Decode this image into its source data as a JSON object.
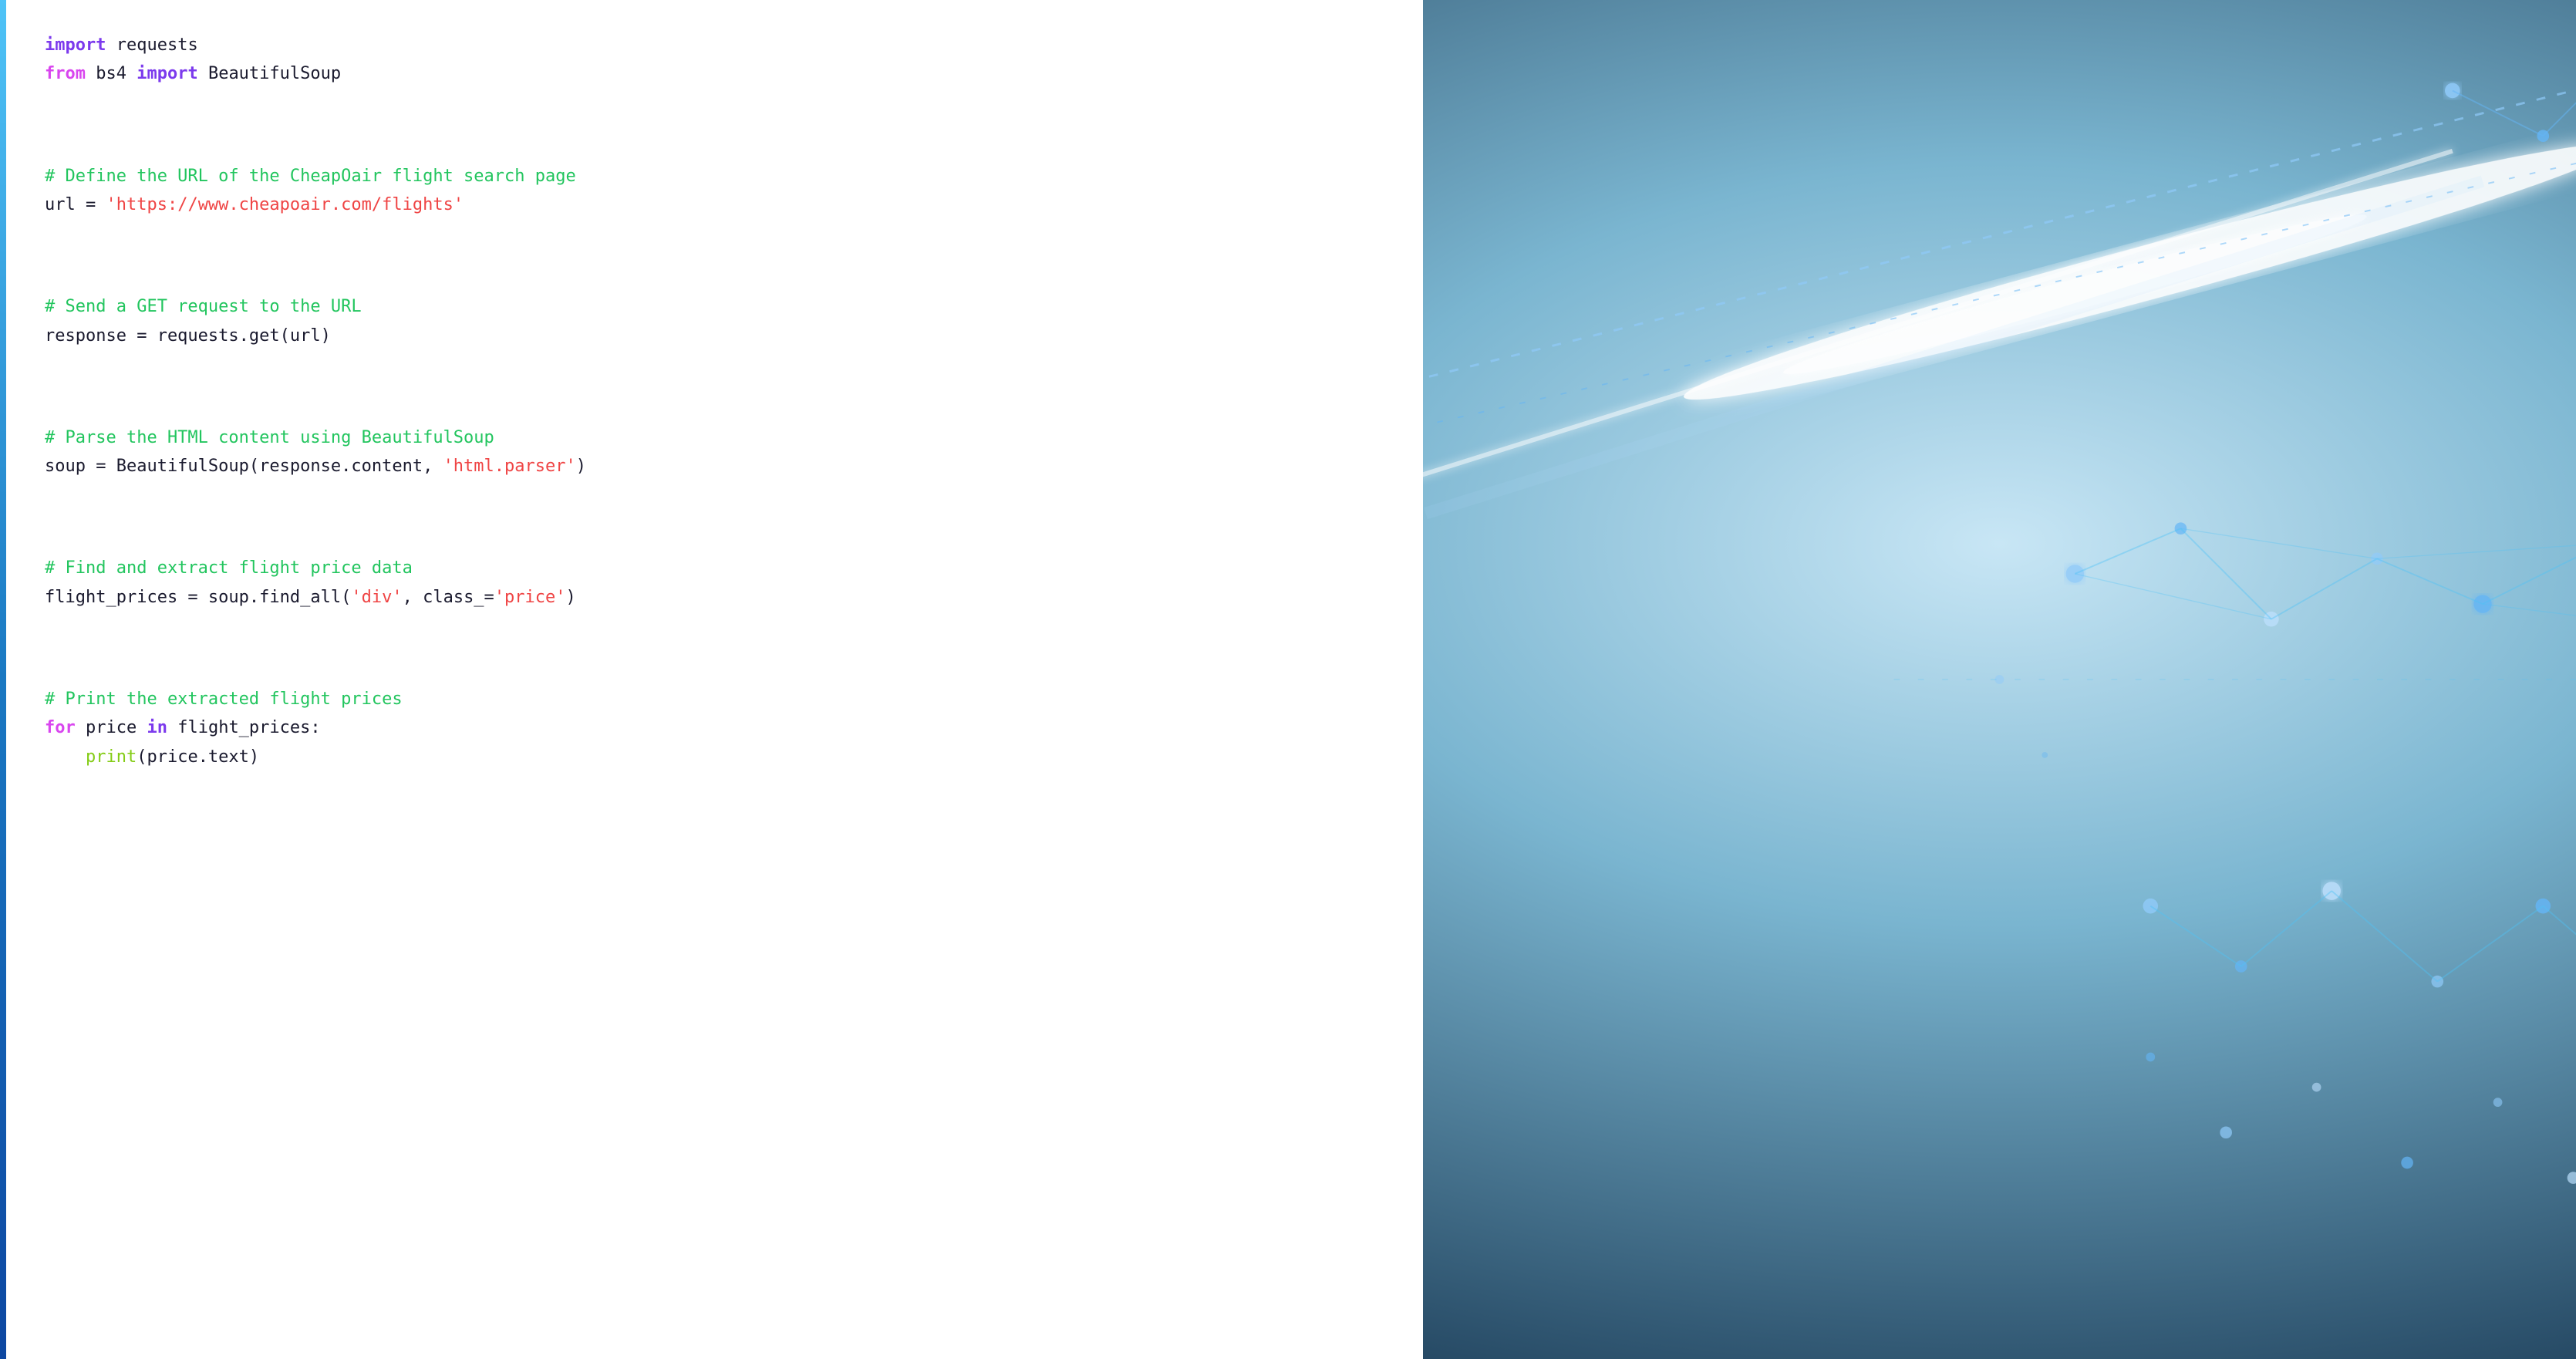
{
  "accent": {
    "color": "#4fc3f7"
  },
  "code": {
    "lines": [
      {
        "id": "line-import-requests",
        "tokens": [
          {
            "type": "kw-import",
            "text": "import"
          },
          {
            "type": "plain",
            "text": " requests"
          }
        ]
      },
      {
        "id": "line-from-bs4",
        "tokens": [
          {
            "type": "kw-from",
            "text": "from"
          },
          {
            "type": "plain",
            "text": " bs4 "
          },
          {
            "type": "kw-import",
            "text": "import"
          },
          {
            "type": "plain",
            "text": " BeautifulSoup"
          }
        ]
      },
      {
        "id": "line-blank-1",
        "tokens": [
          {
            "type": "plain",
            "text": ""
          }
        ]
      },
      {
        "id": "line-comment-url",
        "tokens": [
          {
            "type": "comment",
            "text": "# Define the URL of the CheapOair flight search page"
          }
        ]
      },
      {
        "id": "line-url",
        "tokens": [
          {
            "type": "plain",
            "text": "url = "
          },
          {
            "type": "string",
            "text": "'https://www.cheapoair.com/flights'"
          }
        ]
      },
      {
        "id": "line-blank-2",
        "tokens": [
          {
            "type": "plain",
            "text": ""
          }
        ]
      },
      {
        "id": "line-comment-get",
        "tokens": [
          {
            "type": "comment",
            "text": "# Send a GET request to the URL"
          }
        ]
      },
      {
        "id": "line-response",
        "tokens": [
          {
            "type": "plain",
            "text": "response = requests.get(url)"
          }
        ]
      },
      {
        "id": "line-blank-3",
        "tokens": [
          {
            "type": "plain",
            "text": ""
          }
        ]
      },
      {
        "id": "line-comment-parse",
        "tokens": [
          {
            "type": "comment",
            "text": "# Parse the HTML content using BeautifulSoup"
          }
        ]
      },
      {
        "id": "line-soup",
        "tokens": [
          {
            "type": "plain",
            "text": "soup = BeautifulSoup(response.content, "
          },
          {
            "type": "string",
            "text": "'html.parser'"
          },
          {
            "type": "plain",
            "text": ")"
          }
        ]
      },
      {
        "id": "line-blank-4",
        "tokens": [
          {
            "type": "plain",
            "text": ""
          }
        ]
      },
      {
        "id": "line-comment-find",
        "tokens": [
          {
            "type": "comment",
            "text": "# Find and extract flight price data"
          }
        ]
      },
      {
        "id": "line-flight-prices",
        "tokens": [
          {
            "type": "plain",
            "text": "flight_prices = soup.find_all("
          },
          {
            "type": "string",
            "text": "'div'"
          },
          {
            "type": "plain",
            "text": ", class_="
          },
          {
            "type": "string",
            "text": "'price'"
          },
          {
            "type": "plain",
            "text": ")"
          }
        ]
      },
      {
        "id": "line-blank-5",
        "tokens": [
          {
            "type": "plain",
            "text": ""
          }
        ]
      },
      {
        "id": "line-comment-print",
        "tokens": [
          {
            "type": "comment",
            "text": "# Print the extracted flight prices"
          }
        ]
      },
      {
        "id": "line-for",
        "tokens": [
          {
            "type": "kw-for",
            "text": "for"
          },
          {
            "type": "plain",
            "text": " price "
          },
          {
            "type": "kw-in",
            "text": "in"
          },
          {
            "type": "plain",
            "text": " flight_prices:"
          }
        ]
      },
      {
        "id": "line-print",
        "tokens": [
          {
            "type": "fn",
            "text": "    print"
          },
          {
            "type": "plain",
            "text": "(price.text)"
          }
        ]
      }
    ]
  }
}
